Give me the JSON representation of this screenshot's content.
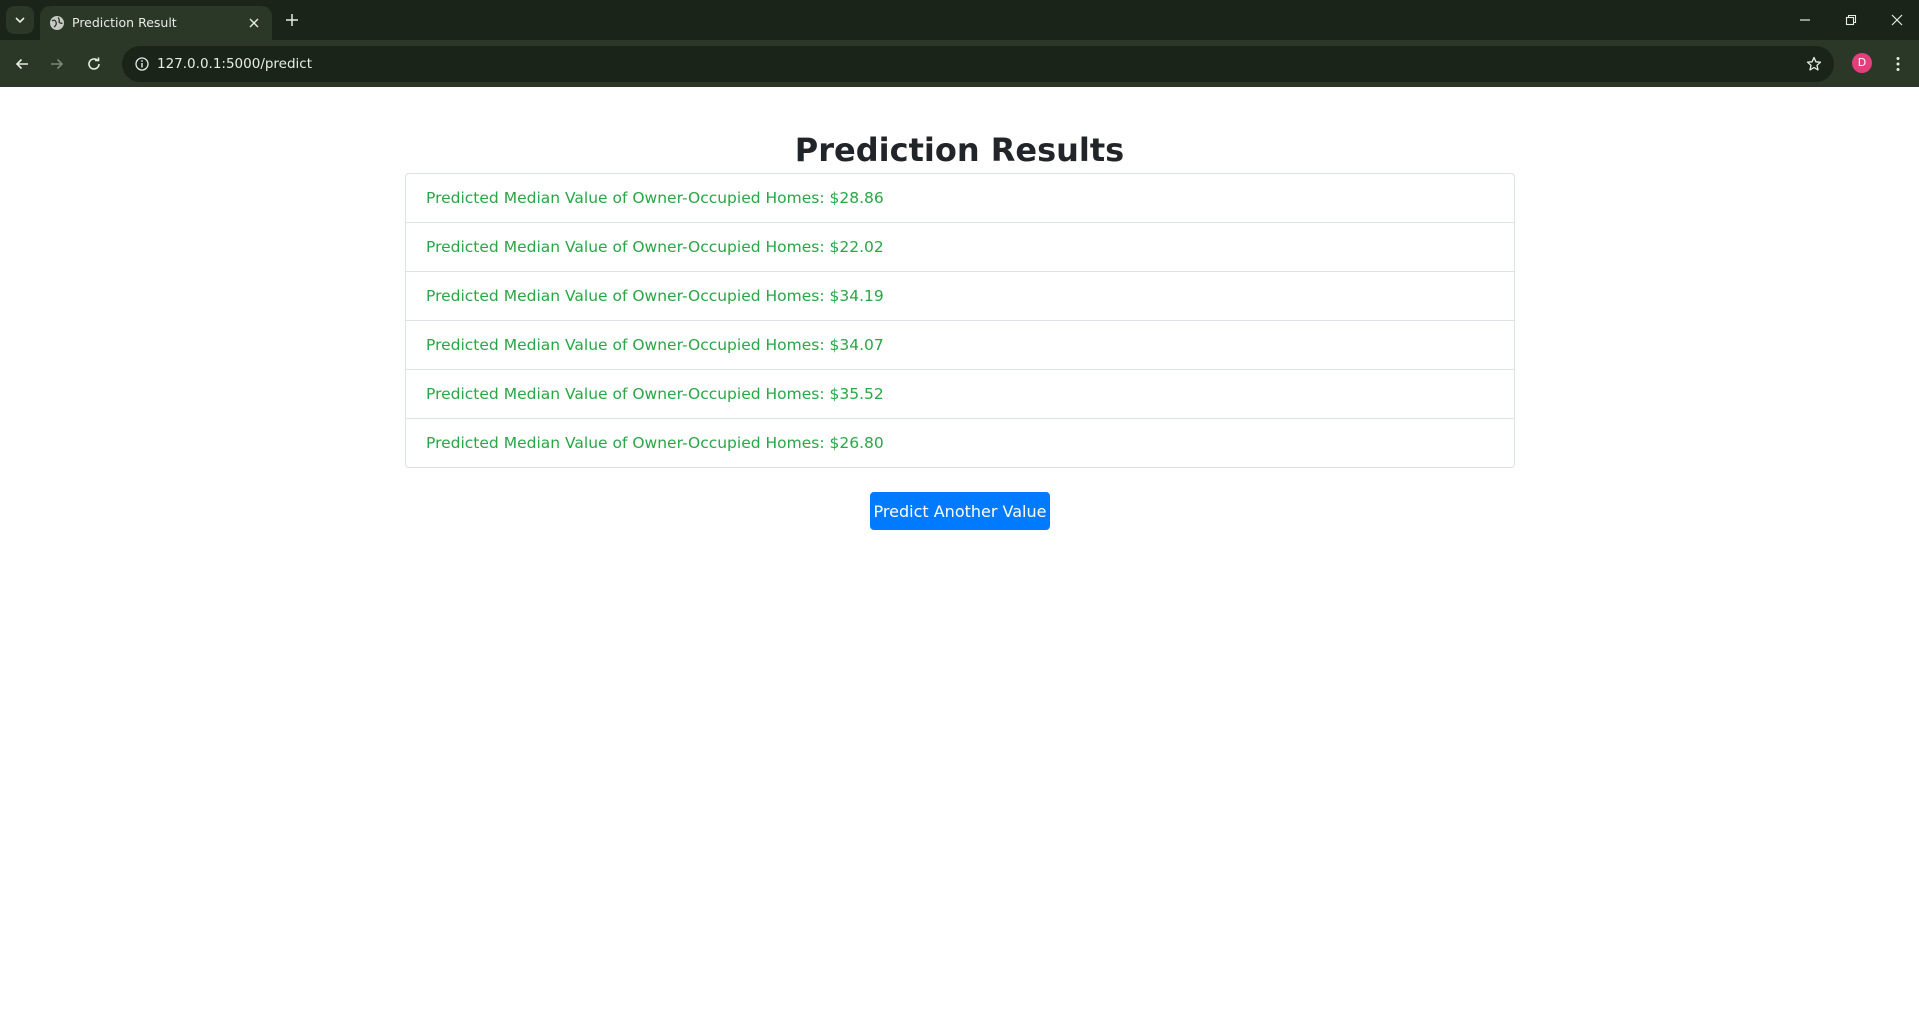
{
  "browser": {
    "tab": {
      "title": "Prediction Result"
    },
    "address_bar": {
      "url": "127.0.0.1:5000/predict"
    },
    "profile": {
      "initial": "D",
      "color": "#e33f7c"
    },
    "theme": {
      "tabbar_bg": "#1b2418",
      "toolbar_bg": "#2b3727"
    },
    "icons": [
      "tab-list-icon",
      "globe-icon",
      "close-icon",
      "plus-icon",
      "minimize-icon",
      "restore-icon",
      "window-close-icon",
      "back-arrow-icon",
      "forward-arrow-icon",
      "reload-icon",
      "site-info-icon",
      "star-icon",
      "kebab-menu-icon"
    ]
  },
  "page": {
    "title": "Prediction Results",
    "results": [
      {
        "text": "Predicted Median Value of Owner-Occupied Homes: $28.86"
      },
      {
        "text": "Predicted Median Value of Owner-Occupied Homes: $22.02"
      },
      {
        "text": "Predicted Median Value of Owner-Occupied Homes: $34.19"
      },
      {
        "text": "Predicted Median Value of Owner-Occupied Homes: $34.07"
      },
      {
        "text": "Predicted Median Value of Owner-Occupied Homes: $35.52"
      },
      {
        "text": "Predicted Median Value of Owner-Occupied Homes: $26.80"
      }
    ],
    "action_button": {
      "label": "Predict Another Value"
    },
    "colors": {
      "result_text": "#28a745",
      "button_bg": "#007bff",
      "heading": "#212529"
    }
  }
}
